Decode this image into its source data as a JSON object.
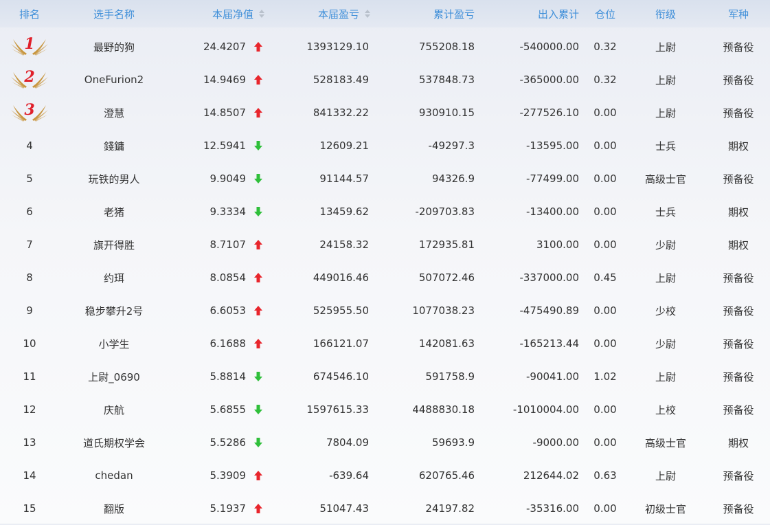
{
  "colors": {
    "header_text": "#3f8fd9",
    "up": "#e8252c",
    "down": "#2fbf3a",
    "medal_gold": "#c8963e",
    "medal_number": "#e0202a"
  },
  "header": {
    "rank": "排名",
    "name": "选手名称",
    "nav": "本届净值",
    "pnl": "本届盈亏",
    "cum_pnl": "累计盈亏",
    "cash_flow": "出入累计",
    "position": "仓位",
    "grade": "衔级",
    "arm": "军种"
  },
  "rows": [
    {
      "rank": "1",
      "medal": true,
      "name": "最野的狗",
      "nav": "24.4207",
      "trend": "up",
      "pnl": "1393129.10",
      "cum_pnl": "755208.18",
      "cash_flow": "-540000.00",
      "position": "0.32",
      "grade": "上尉",
      "arm": "预备役"
    },
    {
      "rank": "2",
      "medal": true,
      "name": "OneFurion2",
      "nav": "14.9469",
      "trend": "up",
      "pnl": "528183.49",
      "cum_pnl": "537848.73",
      "cash_flow": "-365000.00",
      "position": "0.32",
      "grade": "上尉",
      "arm": "预备役"
    },
    {
      "rank": "3",
      "medal": true,
      "name": "澄慧",
      "nav": "14.8507",
      "trend": "up",
      "pnl": "841332.22",
      "cum_pnl": "930910.15",
      "cash_flow": "-277526.10",
      "position": "0.00",
      "grade": "上尉",
      "arm": "预备役"
    },
    {
      "rank": "4",
      "medal": false,
      "name": "錢鏞",
      "nav": "12.5941",
      "trend": "down",
      "pnl": "12609.21",
      "cum_pnl": "-49297.3",
      "cash_flow": "-13595.00",
      "position": "0.00",
      "grade": "士兵",
      "arm": "期权"
    },
    {
      "rank": "5",
      "medal": false,
      "name": "玩铁的男人",
      "nav": "9.9049",
      "trend": "down",
      "pnl": "91144.57",
      "cum_pnl": "94326.9",
      "cash_flow": "-77499.00",
      "position": "0.00",
      "grade": "高级士官",
      "arm": "预备役"
    },
    {
      "rank": "6",
      "medal": false,
      "name": "老猪",
      "nav": "9.3334",
      "trend": "down",
      "pnl": "13459.62",
      "cum_pnl": "-209703.83",
      "cash_flow": "-13400.00",
      "position": "0.00",
      "grade": "士兵",
      "arm": "期权"
    },
    {
      "rank": "7",
      "medal": false,
      "name": "旗开得胜",
      "nav": "8.7107",
      "trend": "up",
      "pnl": "24158.32",
      "cum_pnl": "172935.81",
      "cash_flow": "3100.00",
      "position": "0.00",
      "grade": "少尉",
      "arm": "期权"
    },
    {
      "rank": "8",
      "medal": false,
      "name": "约珥",
      "nav": "8.0854",
      "trend": "up",
      "pnl": "449016.46",
      "cum_pnl": "507072.46",
      "cash_flow": "-337000.00",
      "position": "0.45",
      "grade": "上尉",
      "arm": "预备役"
    },
    {
      "rank": "9",
      "medal": false,
      "name": "稳步攀升2号",
      "nav": "6.6053",
      "trend": "up",
      "pnl": "525955.50",
      "cum_pnl": "1077038.23",
      "cash_flow": "-475490.89",
      "position": "0.00",
      "grade": "少校",
      "arm": "预备役"
    },
    {
      "rank": "10",
      "medal": false,
      "name": "小学生",
      "nav": "6.1688",
      "trend": "up",
      "pnl": "166121.07",
      "cum_pnl": "142081.63",
      "cash_flow": "-165213.44",
      "position": "0.00",
      "grade": "少尉",
      "arm": "预备役"
    },
    {
      "rank": "11",
      "medal": false,
      "name": "上尉_0690",
      "nav": "5.8814",
      "trend": "down",
      "pnl": "674546.10",
      "cum_pnl": "591758.9",
      "cash_flow": "-90041.00",
      "position": "1.02",
      "grade": "上尉",
      "arm": "预备役"
    },
    {
      "rank": "12",
      "medal": false,
      "name": "庆航",
      "nav": "5.6855",
      "trend": "down",
      "pnl": "1597615.33",
      "cum_pnl": "4488830.18",
      "cash_flow": "-1010004.00",
      "position": "0.00",
      "grade": "上校",
      "arm": "预备役"
    },
    {
      "rank": "13",
      "medal": false,
      "name": "道氏期权学会",
      "nav": "5.5286",
      "trend": "down",
      "pnl": "7804.09",
      "cum_pnl": "59693.9",
      "cash_flow": "-9000.00",
      "position": "0.00",
      "grade": "高级士官",
      "arm": "期权"
    },
    {
      "rank": "14",
      "medal": false,
      "name": "chedan",
      "nav": "5.3909",
      "trend": "up",
      "pnl": "-639.64",
      "cum_pnl": "620765.46",
      "cash_flow": "212644.02",
      "position": "0.63",
      "grade": "上尉",
      "arm": "预备役"
    },
    {
      "rank": "15",
      "medal": false,
      "name": "翻版",
      "nav": "5.1937",
      "trend": "up",
      "pnl": "51047.43",
      "cum_pnl": "24197.82",
      "cash_flow": "-35316.00",
      "position": "0.00",
      "grade": "初级士官",
      "arm": "预备役"
    }
  ]
}
